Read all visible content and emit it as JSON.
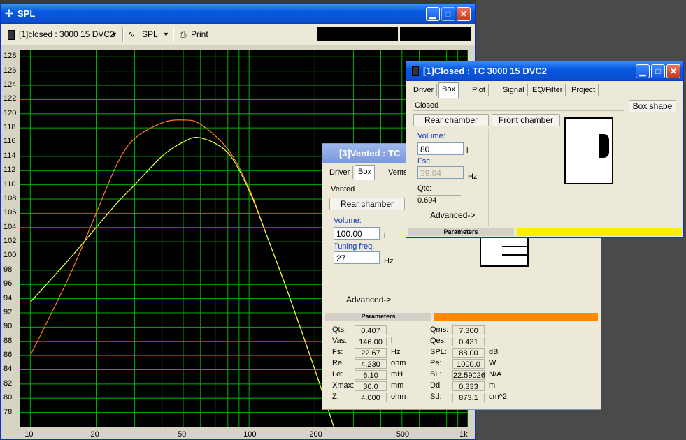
{
  "spl_window": {
    "title": "SPL",
    "toolbar": {
      "project_select": "[1]closed : 3000 15 DVC2",
      "plot_select": "SPL",
      "print_label": "Print"
    },
    "graph": {
      "y_ticks": [
        "128",
        "126",
        "124",
        "122",
        "120",
        "118",
        "116",
        "114",
        "112",
        "110",
        "108",
        "106",
        "104",
        "102",
        "100",
        "98",
        "96",
        "94",
        "92",
        "90",
        "88",
        "86",
        "84",
        "82",
        "80",
        "78"
      ],
      "x_ticks": [
        "10",
        "20",
        "50",
        "100",
        "200",
        "500",
        "1k"
      ]
    }
  },
  "chart_data": {
    "type": "line",
    "xlabel": "",
    "ylabel": "",
    "x_scale": "log",
    "xlim": [
      9,
      1000
    ],
    "ylim": [
      76,
      129
    ],
    "grid": true,
    "series": [
      {
        "color": "#ff7a2a",
        "x": [
          10,
          15,
          20,
          25,
          30,
          40,
          50,
          60,
          80,
          100,
          120,
          150,
          200,
          250
        ],
        "y": [
          86,
          97,
          106,
          113,
          116.5,
          118.7,
          119.1,
          118.5,
          115,
          109.5,
          103,
          95,
          84,
          75
        ]
      },
      {
        "color": "#f0ff40",
        "x": [
          10,
          15,
          20,
          25,
          30,
          40,
          50,
          60,
          80,
          100,
          120,
          150,
          200,
          250
        ],
        "y": [
          93.5,
          99.5,
          104,
          107.5,
          110,
          114,
          116,
          116.6,
          114.5,
          109.2,
          103,
          95,
          84,
          75
        ]
      }
    ]
  },
  "vented_window": {
    "title": "[3]Vented : TC",
    "tabs": [
      "Driver",
      "Box",
      "Vents"
    ],
    "type_text": "Vented",
    "rear_chamber": "Rear chamber",
    "volume_label": "Volume:",
    "volume_value": "100.00",
    "volume_unit": "l",
    "tuning_label": "Tuning freq.",
    "tuning_value": "27",
    "tuning_unit": "Hz",
    "advanced": "Advanced->",
    "params_label": "Parameters",
    "params_left": [
      {
        "label": "Qts:",
        "value": "0.407",
        "unit": ""
      },
      {
        "label": "Vas:",
        "value": "146.00",
        "unit": "l"
      },
      {
        "label": "Fs:",
        "value": "22.67",
        "unit": "Hz"
      },
      {
        "label": "Re:",
        "value": "4.230",
        "unit": "ohm"
      },
      {
        "label": "Le:",
        "value": "6.10",
        "unit": "mH"
      },
      {
        "label": "Xmax:",
        "value": "30.0",
        "unit": "mm"
      },
      {
        "label": "Z:",
        "value": "4.000",
        "unit": "ohm"
      }
    ],
    "params_right": [
      {
        "label": "Qms:",
        "value": "7.300",
        "unit": ""
      },
      {
        "label": "Qes:",
        "value": "0.431",
        "unit": ""
      },
      {
        "label": "SPL:",
        "value": "88.00",
        "unit": "dB"
      },
      {
        "label": "Pe:",
        "value": "1000.0",
        "unit": "W"
      },
      {
        "label": "BL:",
        "value": "22.59026",
        "unit": "N/A"
      },
      {
        "label": "Dd:",
        "value": "0.333",
        "unit": "m"
      },
      {
        "label": "Sd:",
        "value": "873.1",
        "unit": "cm^2"
      }
    ]
  },
  "closed_window": {
    "title": "[1]Closed : TC 3000 15 DVC2",
    "tabs": [
      "Driver",
      "Box",
      "Plot",
      "Signal",
      "EQ/Filter",
      "Project"
    ],
    "type_text": "Closed",
    "box_shape": "Box shape",
    "rear_chamber": "Rear chamber",
    "front_chamber": "Front chamber",
    "volume_label": "Volume:",
    "volume_value": "80",
    "volume_unit": "l",
    "fsc_label": "Fsc:",
    "fsc_value": "39.84",
    "fsc_unit": "Hz",
    "qtc_label": "Qtc:",
    "qtc_value": "0.694",
    "advanced": "Advanced->",
    "params_label": "Parameters"
  }
}
